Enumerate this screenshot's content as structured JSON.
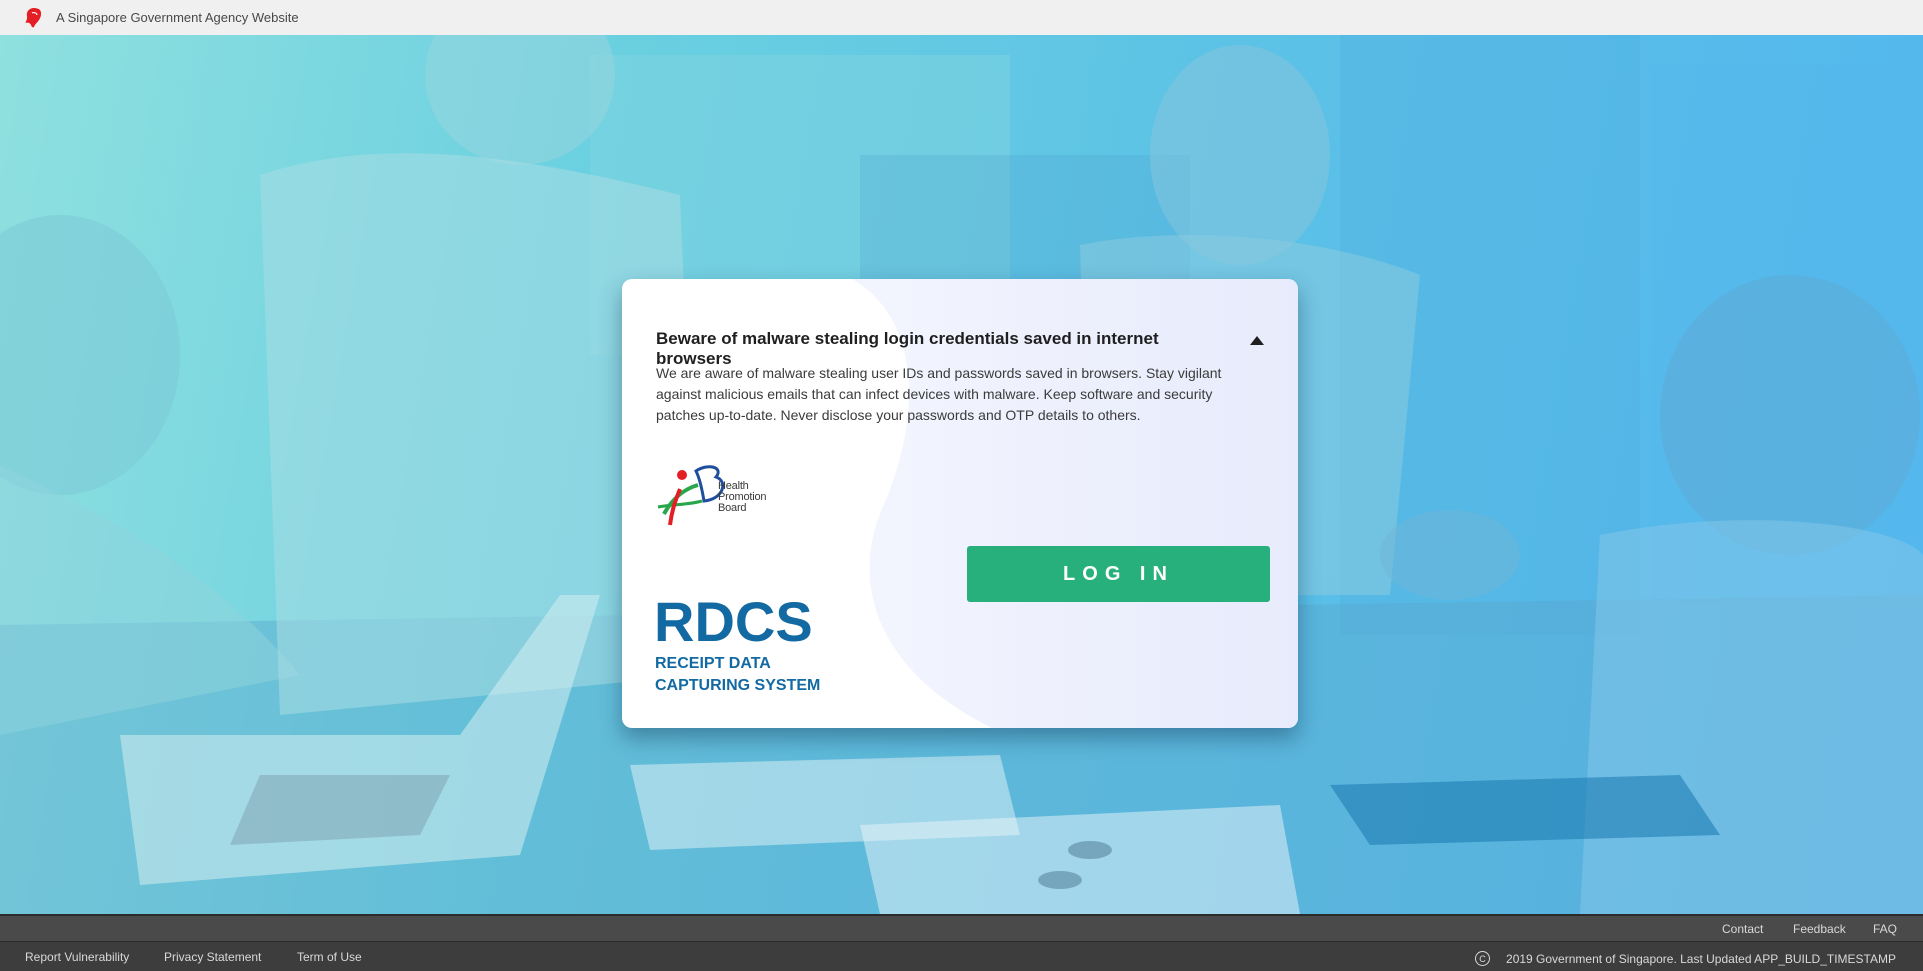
{
  "masthead": {
    "text": "A Singapore Government Agency Website",
    "icon": "lion-head-icon",
    "icon_color": "#e31e24"
  },
  "notice": {
    "title": "Beware of malware stealing login credentials saved in internet browsers",
    "body": "We are aware of malware stealing user IDs and passwords saved in browsers. Stay vigilant against malicious emails that can infect devices with malware. Keep software and security patches up-to-date. Never disclose your passwords and OTP details to others.",
    "toggle_icon": "caret-up-icon",
    "expanded": true
  },
  "logo": {
    "line1": "Health",
    "line2": "Promotion",
    "line3": "Board"
  },
  "login": {
    "label": "LOG IN",
    "color": "#27b07b"
  },
  "product": {
    "acronym": "RDCS",
    "line1": "RECEIPT DATA",
    "line2": "CAPTURING SYSTEM",
    "color": "#136aa3"
  },
  "footer": {
    "top_links": [
      "Contact",
      "Feedback",
      "FAQ"
    ],
    "bottom_links": [
      "Report Vulnerability",
      "Privacy Statement",
      "Term of Use"
    ],
    "copyright": "2019 Government of Singapore. Last Updated APP_BUILD_TIMESTAMP",
    "copyright_symbol": "C"
  }
}
